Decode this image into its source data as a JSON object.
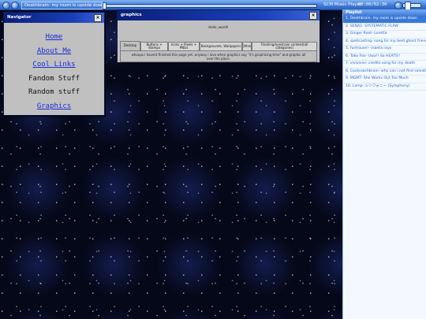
{
  "player": {
    "now_playing": "Deathbrain- my room is upside down",
    "title": "SCM Music Player",
    "time": "00:00/02:30"
  },
  "navigator": {
    "title": "Navigator",
    "items": [
      {
        "label": "Home",
        "link": true
      },
      {
        "label": "About Me",
        "link": true
      },
      {
        "label": "Cool Links",
        "link": true
      },
      {
        "label": "Fandom Stuff",
        "link": false
      },
      {
        "label": "Random stuff",
        "link": false
      },
      {
        "label": "Graphics",
        "link": true
      }
    ]
  },
  "graphics": {
    "title": "graphics",
    "hello": "Hello, world!",
    "tabs": [
      {
        "label": "Desktop"
      },
      {
        "label": "Buttons + Stamps"
      },
      {
        "label": "Icons + Pixels + PNGs"
      },
      {
        "label": "Backgrounds, Wallpapers"
      },
      {
        "label": "Other"
      },
      {
        "label": "Flashing/eyestrain content(all categories)"
      }
    ],
    "panel_text": "whoops i havent finished this page yet. anyway i love when graphics say \"it's graphicing time\" and graphic all over the place."
  },
  "playlist": {
    "title": "Playlist",
    "items": [
      "1. Deathbrain- my room is upside down",
      "2. SENA1- SYSTEMATIC FLAW",
      "3. Ginger Root- Loretta",
      "4. spellcasting- song for my best ghost friend",
      "5. funhouse!- manta rays",
      "6. Toby Fox- Uwa!! So HEATS!!",
      "7. vivivivivi- credits song for my death",
      "8. Cockroachbrain- why can i not find salvation",
      "9. MGMT- She Works Out Too Much",
      "10. Lamp- シンフォニー (Symphony)"
    ]
  }
}
